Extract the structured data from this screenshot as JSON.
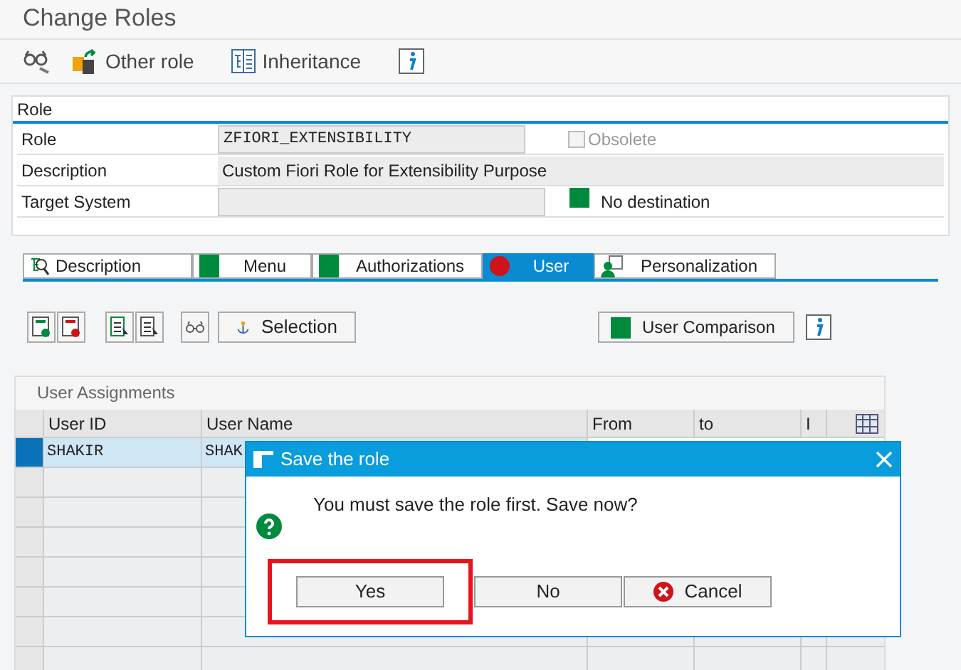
{
  "window": {
    "title": "Change Roles"
  },
  "toolbar": [
    {
      "kind": "glasses"
    },
    {
      "kind": "other-role",
      "label": "Other role"
    },
    {
      "kind": "inheritance",
      "label": "Inheritance"
    },
    {
      "kind": "info"
    }
  ],
  "role_section": {
    "title": "Role",
    "role": {
      "label": "Role",
      "value": "ZFIORI_EXTENSIBILITY"
    },
    "obsolete": {
      "label": "Obsolete",
      "checked": false
    },
    "description": {
      "label": "Description",
      "value": "Custom Fiori Role for Extensibility Purpose"
    },
    "target_system": {
      "label": "Target System",
      "status": "No destination",
      "color": "#008a3e"
    }
  },
  "tabs": [
    {
      "label": "Description",
      "kind": "tree",
      "selected": false
    },
    {
      "label": "Menu",
      "kind": "status",
      "color": "#008a3e",
      "selected": false
    },
    {
      "label": "Authorizations",
      "kind": "status",
      "color": "#008a3e",
      "selected": false
    },
    {
      "label": "User",
      "kind": "status",
      "color": "#d0121b",
      "selected": true
    },
    {
      "label": "Personalization",
      "kind": "person",
      "selected": false
    }
  ],
  "user_toolbar": {
    "selection": "Selection",
    "comparison": {
      "label": "User Comparison",
      "color": "#008a3e"
    }
  },
  "table": {
    "title": "User Assignments",
    "columns": [
      "User ID",
      "User Name",
      "From",
      "to",
      "I"
    ],
    "rows": [
      {
        "cells": [
          "SHAKIR",
          "SHAK"
        ],
        "selected": true
      }
    ]
  },
  "dialog": {
    "title": "Save the role",
    "message": "You must save the role first. Save now?",
    "buttons": [
      {
        "label": "Yes",
        "kind": "plain",
        "highlighted": true
      },
      {
        "label": "No",
        "kind": "plain",
        "highlighted": false
      },
      {
        "label": "Cancel",
        "kind": "cancel",
        "highlighted": false
      }
    ]
  }
}
